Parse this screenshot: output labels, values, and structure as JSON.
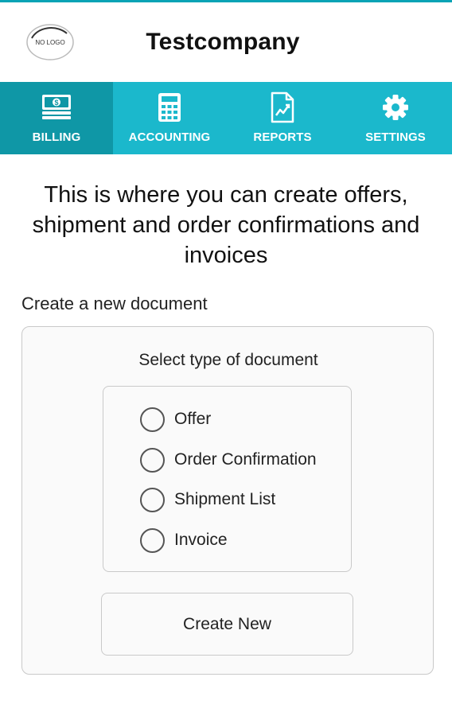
{
  "app": {
    "title": "Testcompany",
    "logo_text": "NO LOGO",
    "accent_color": "#1bb8cc",
    "active_tab_color": "#0f97a6"
  },
  "nav": {
    "tabs": [
      {
        "label": "BILLING",
        "icon": "money-icon",
        "active": true
      },
      {
        "label": "ACCOUNTING",
        "icon": "calculator-icon",
        "active": false
      },
      {
        "label": "REPORTS",
        "icon": "report-chart-icon",
        "active": false
      },
      {
        "label": "SETTINGS",
        "icon": "gear-icon",
        "active": false
      }
    ]
  },
  "main": {
    "intro": "This is where you can create offers, shipment and order confirmations and invoices",
    "section_label": "Create a new document",
    "card": {
      "title": "Select type of document",
      "options": [
        {
          "label": "Offer",
          "selected": false
        },
        {
          "label": "Order Confirmation",
          "selected": false
        },
        {
          "label": "Shipment List",
          "selected": false
        },
        {
          "label": "Invoice",
          "selected": false
        }
      ],
      "create_button": "Create New"
    }
  }
}
